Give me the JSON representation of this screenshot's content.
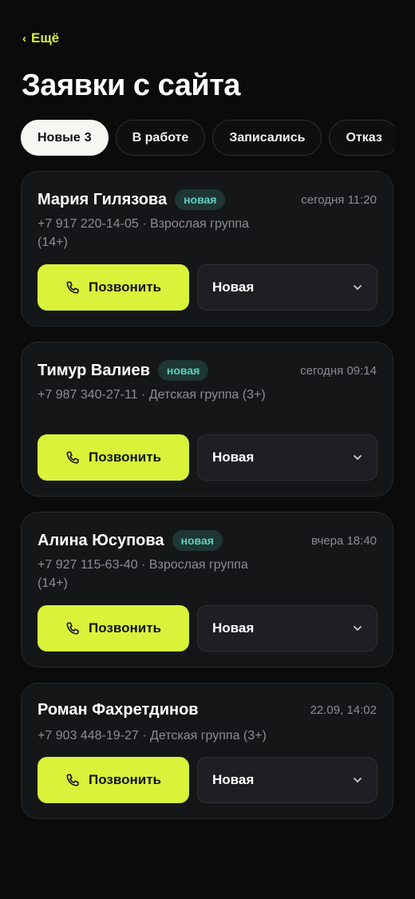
{
  "header": {
    "back_label": "Ещё",
    "title": "Заявки с сайта"
  },
  "tabs": [
    {
      "label": "Новые",
      "count": "3",
      "active": true
    },
    {
      "label": "В работе"
    },
    {
      "label": "Записались"
    },
    {
      "label": "Отказ"
    }
  ],
  "cards": [
    {
      "name": "Мария Гилязова",
      "badge": "новая",
      "time": "сегодня 11:20",
      "meta": "+7 917 220-14-05 · Взрослая группа (14+)",
      "call_label": "Позвонить",
      "status": "Новая"
    },
    {
      "name": "Тимур Валиев",
      "badge": "новая",
      "time": "сегодня 09:14",
      "meta": "+7 987 340-27-11 · Детская группа (3+)",
      "call_label": "Позвонить",
      "status": "Новая"
    },
    {
      "name": "Алина Юсупова",
      "badge": "новая",
      "time": "вчера 18:40",
      "meta": "+7 927 115-63-40 · Взрослая группа (14+)",
      "call_label": "Позвонить",
      "status": "Новая"
    },
    {
      "name": "Роман Фахретдинов",
      "time": "22.09, 14:02",
      "meta": "+7 903 448-19-27 · Детская группа (3+)",
      "call_label": "Позвонить",
      "status": "Новая"
    }
  ],
  "colors": {
    "accent": "#d9f33a",
    "badge_bg": "#1e3634",
    "badge_text": "#5fd0c0",
    "background": "#0b0b0b",
    "card_bg": "#151618"
  }
}
